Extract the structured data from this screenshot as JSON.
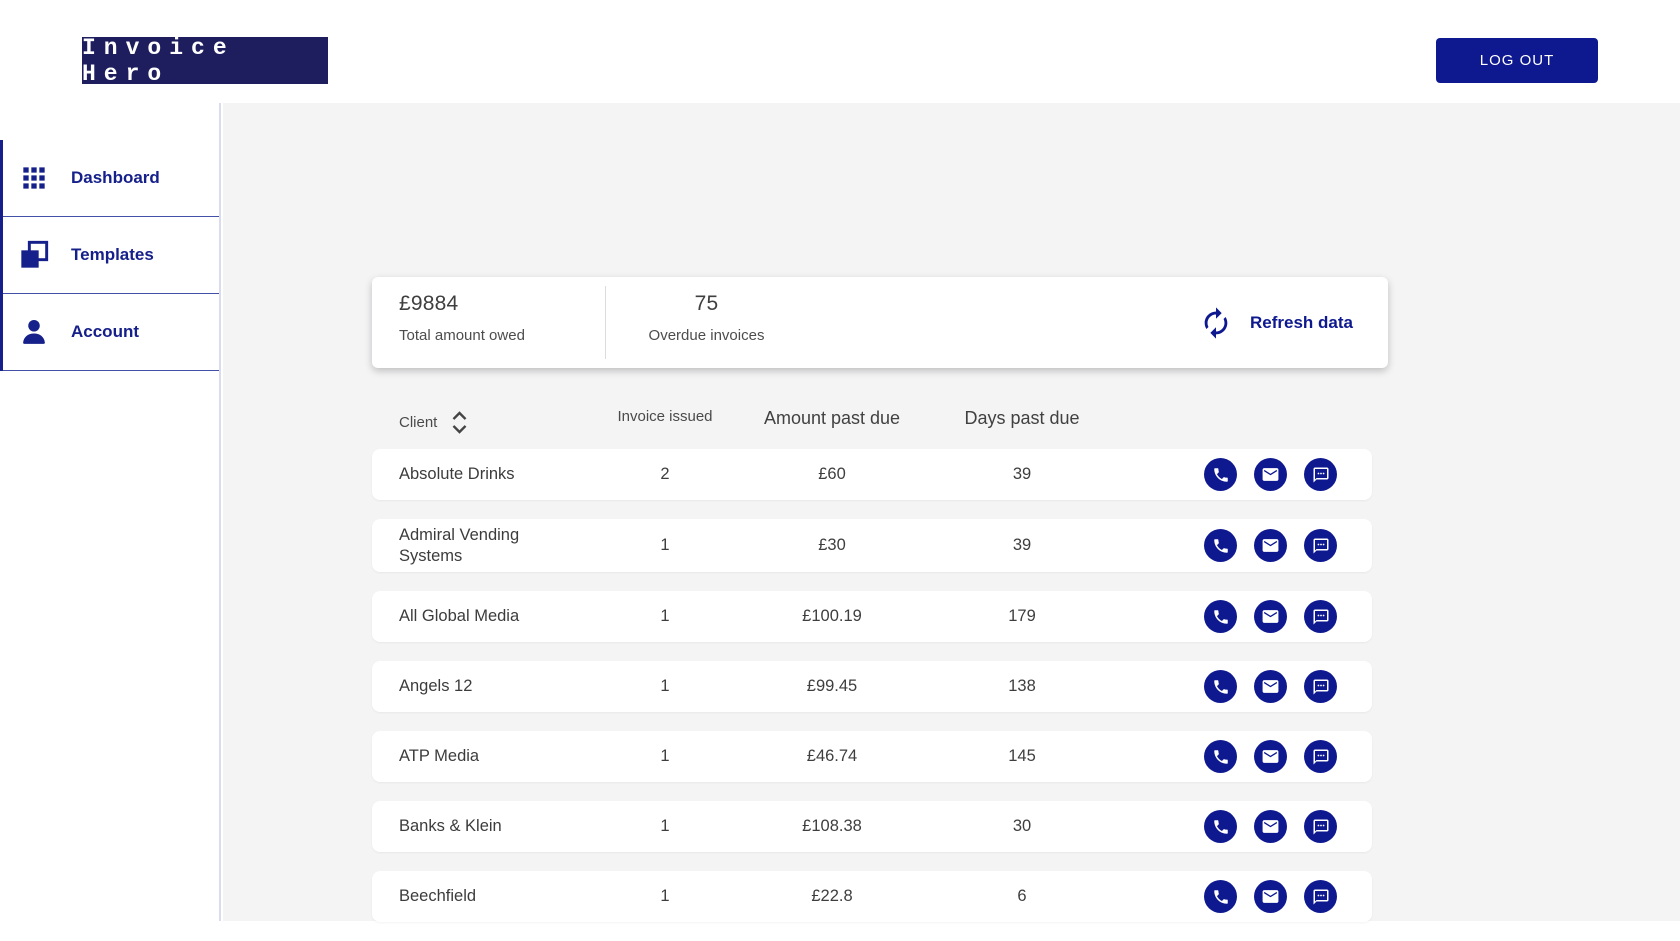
{
  "header": {
    "logo": "Invoice Hero",
    "logout_label": "LOG OUT"
  },
  "sidebar": {
    "items": [
      {
        "label": "Dashboard",
        "icon": "grid-icon"
      },
      {
        "label": "Templates",
        "icon": "copy-icon"
      },
      {
        "label": "Account",
        "icon": "person-icon"
      }
    ]
  },
  "summary": {
    "stats": [
      {
        "value": "£9884",
        "label": "Total amount owed"
      },
      {
        "value": "75",
        "label": "Overdue invoices"
      }
    ],
    "refresh_label": "Refresh data"
  },
  "table": {
    "columns": [
      "Client",
      "Invoice issued",
      "Amount past due",
      "Days past due"
    ],
    "rows": [
      {
        "client": "Absolute Drinks",
        "invoices": "2",
        "amount": "£60",
        "days": "39"
      },
      {
        "client": "Admiral Vending Systems",
        "invoices": "1",
        "amount": "£30",
        "days": "39"
      },
      {
        "client": "All Global Media",
        "invoices": "1",
        "amount": "£100.19",
        "days": "179"
      },
      {
        "client": "Angels 12",
        "invoices": "1",
        "amount": "£99.45",
        "days": "138"
      },
      {
        "client": "ATP Media",
        "invoices": "1",
        "amount": "£46.74",
        "days": "145"
      },
      {
        "client": "Banks & Klein",
        "invoices": "1",
        "amount": "£108.38",
        "days": "30"
      },
      {
        "client": "Beechfield",
        "invoices": "1",
        "amount": "£22.8",
        "days": "6"
      }
    ],
    "row_actions": [
      "phone",
      "email",
      "sms"
    ]
  },
  "colors": {
    "brand_navy": "#1e1e5e",
    "primary_blue": "#0e1990",
    "sidebar_blue": "#16208a",
    "content_bg": "#f4f4f5"
  }
}
